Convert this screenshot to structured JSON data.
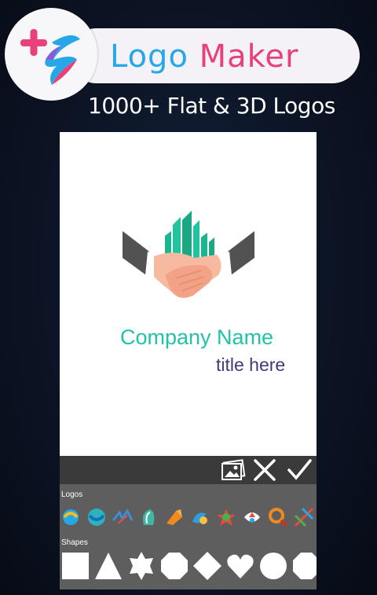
{
  "header": {
    "title_part1": "Logo",
    "title_part2": "Maker",
    "subtitle": "1000+ Flat & 3D Logos",
    "colors": {
      "blue": "#26a7e8",
      "pink": "#e8407a"
    }
  },
  "canvas": {
    "company_name": "Company Name",
    "tagline": "title here",
    "colors": {
      "company": "#22c2a9",
      "tagline": "#3e3c78"
    }
  },
  "toolbar": {
    "icons": [
      "gallery-icon",
      "close-icon",
      "check-icon"
    ]
  },
  "panel": {
    "logos_label": "Logos",
    "shapes_label": "Shapes",
    "logo_icons": [
      "logo-thumb-1",
      "logo-thumb-2",
      "logo-thumb-3",
      "logo-thumb-4",
      "logo-thumb-5",
      "logo-thumb-6",
      "logo-thumb-7",
      "logo-thumb-8",
      "logo-thumb-9",
      "logo-thumb-10"
    ],
    "shape_icons": [
      "square-shape",
      "triangle-shape",
      "star-burst-shape",
      "octagon-shape",
      "diamond-shape",
      "heart-shape",
      "circle-shape",
      "octagon-shape"
    ]
  }
}
